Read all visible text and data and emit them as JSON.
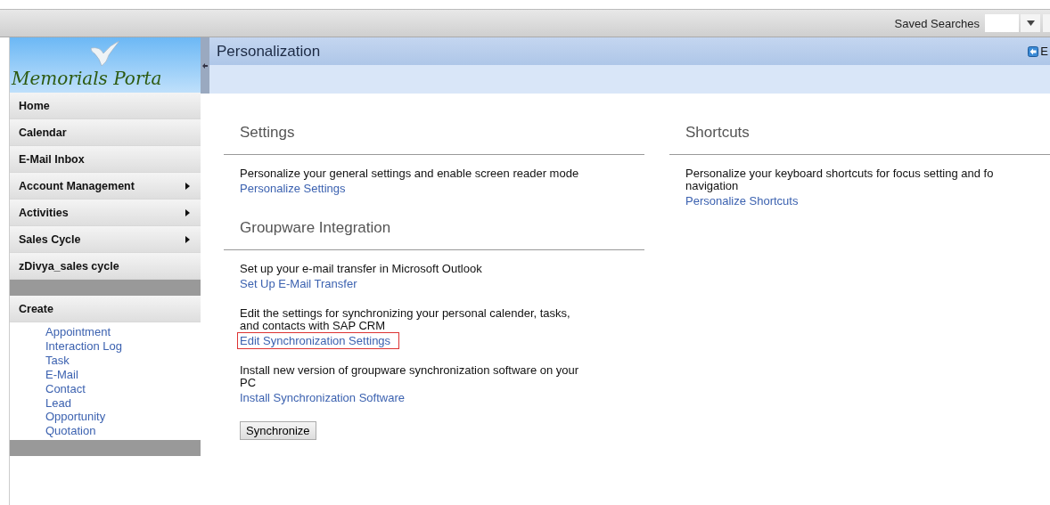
{
  "top_bar": {
    "saved_searches_label": "Saved Searches"
  },
  "sidebar": {
    "logo_text": "Memorials Porta",
    "nav": [
      {
        "label": "Home",
        "has_submenu": false
      },
      {
        "label": "Calendar",
        "has_submenu": false
      },
      {
        "label": "E-Mail Inbox",
        "has_submenu": false
      },
      {
        "label": "Account Management",
        "has_submenu": true
      },
      {
        "label": "Activities",
        "has_submenu": true
      },
      {
        "label": "Sales Cycle",
        "has_submenu": true
      },
      {
        "label": "zDivya_sales cycle",
        "has_submenu": false
      }
    ],
    "create": {
      "title": "Create",
      "links": [
        "Appointment",
        "Interaction Log",
        "Task",
        "E-Mail",
        "Contact",
        "Lead",
        "Opportunity",
        "Quotation"
      ]
    }
  },
  "page": {
    "title": "Personalization",
    "back_link": "E"
  },
  "columns": [
    [
      {
        "title": "Settings",
        "entries": [
          {
            "lines": [
              "Personalize your general settings and enable screen reader mode"
            ],
            "link": "Personalize Settings",
            "highlighted": false
          }
        ]
      },
      {
        "title": "Groupware Integration",
        "entries": [
          {
            "lines": [
              "Set up your e-mail transfer in Microsoft Outlook"
            ],
            "link": "Set Up E-Mail Transfer",
            "highlighted": false
          },
          {
            "lines": [
              "Edit the settings for synchronizing your personal calender, tasks,",
              "and contacts with SAP CRM"
            ],
            "link": "Edit Synchronization Settings",
            "highlighted": true
          },
          {
            "lines": [
              "Install new version of groupware synchronization software on your",
              "PC"
            ],
            "link": "Install Synchronization Software",
            "highlighted": false
          }
        ],
        "button": "Synchronize"
      }
    ],
    [
      {
        "title": "Shortcuts",
        "entries": [
          {
            "lines": [
              "Personalize your keyboard shortcuts for focus setting and fo",
              "navigation"
            ],
            "link": "Personalize Shortcuts",
            "highlighted": false
          }
        ]
      }
    ]
  ]
}
